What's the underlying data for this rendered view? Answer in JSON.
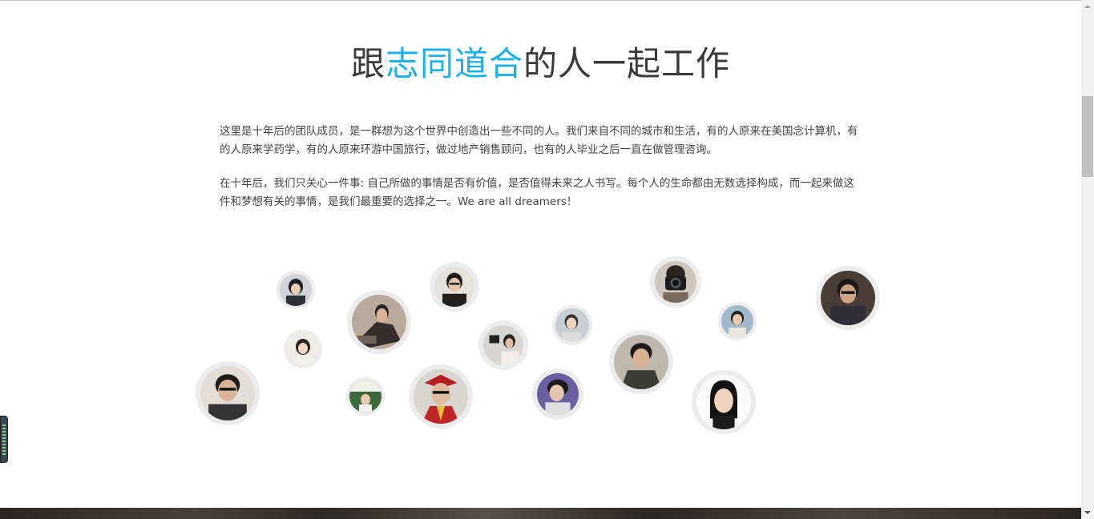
{
  "heading": {
    "prefix": "跟",
    "highlight": "志同道合",
    "suffix": "的人一起工作",
    "highlight_color": "#1cb0ea"
  },
  "intro": {
    "paragraph1": "这里是十年后的团队成员，是一群想为这个世界中创造出一些不同的人。我们来自不同的城市和生活，有的人原来在美国念计算机，有的人原来学药学，有的人原来环游中国旅行，做过地产销售顾问，也有的人毕业之后一直在做管理咨询。",
    "paragraph2": "在十年后，我们只关心一件事: 自己所做的事情是否有价值，是否值得未来之人书写。每个人的生命都由无数选择构成，而一起来做这件和梦想有关的事情，是我们最重要的选择之一。We are all dreamers！"
  },
  "team": {
    "members": [
      {
        "id": "member-1"
      },
      {
        "id": "member-2"
      },
      {
        "id": "member-3"
      },
      {
        "id": "member-4"
      },
      {
        "id": "member-5"
      },
      {
        "id": "member-6"
      },
      {
        "id": "member-7"
      },
      {
        "id": "member-8"
      },
      {
        "id": "member-9"
      },
      {
        "id": "member-10"
      },
      {
        "id": "member-11"
      },
      {
        "id": "member-12"
      },
      {
        "id": "member-13"
      },
      {
        "id": "member-14"
      },
      {
        "id": "member-15"
      },
      {
        "id": "member-16"
      },
      {
        "id": "member-17"
      }
    ]
  }
}
